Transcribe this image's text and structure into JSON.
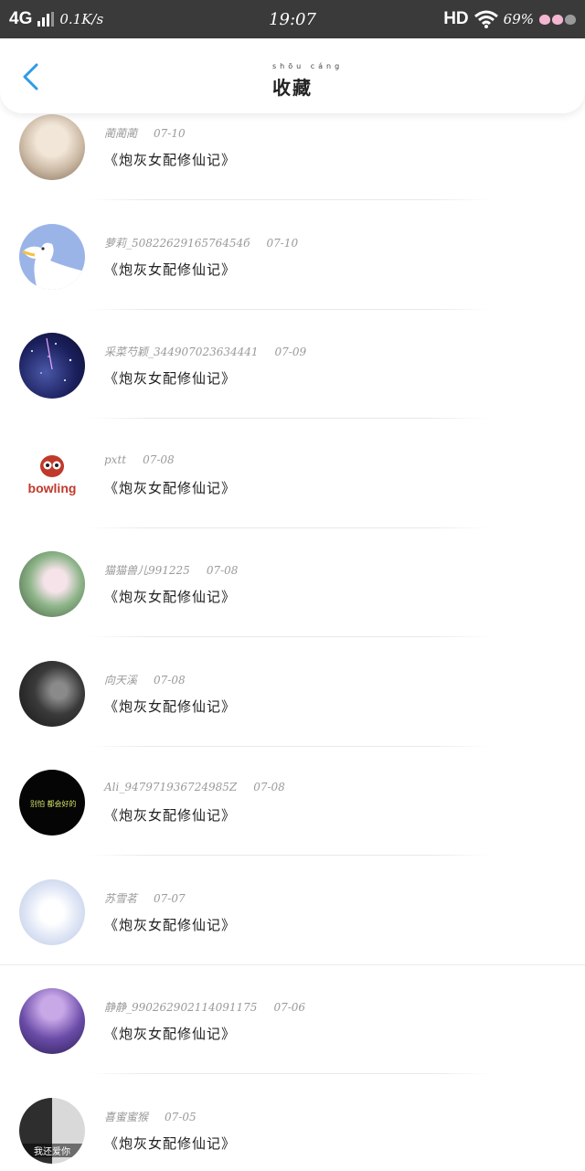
{
  "status_bar": {
    "network": "4G",
    "speed": "0.1K/s",
    "time": "19:07",
    "hd": "HD",
    "battery": "69%"
  },
  "header": {
    "title": "收藏",
    "title_pinyin": "shōu cáng"
  },
  "items": [
    {
      "name": "蔺蔺蔺",
      "date": "07-10",
      "book": "《炮灰女配修仙记》",
      "avatar_colors": [
        "#c9b7a2",
        "#f2e6d8"
      ]
    },
    {
      "name": "萝莉_5082262916576454б",
      "date": "07-10",
      "book": "《炮灰女配修仙记》",
      "avatar_colors": [
        "#9bb4e8",
        "#ffffff"
      ]
    },
    {
      "name": "采菜芍颖_344907023634441",
      "date": "07-09",
      "book": "《炮灰女配修仙记》",
      "avatar_colors": [
        "#1a1f5c",
        "#4a58a8"
      ]
    },
    {
      "name": "pxtt",
      "date": "07-08",
      "book": "《炮灰女配修仙记》",
      "avatar_colors": [
        "#ffffff",
        "#c0392b"
      ]
    },
    {
      "name": "猫猫兽儿991225",
      "date": "07-08",
      "book": "《炮灰女配修仙记》",
      "avatar_colors": [
        "#8fb58a",
        "#f0dce4"
      ]
    },
    {
      "name": "向天溪",
      "date": "07-08",
      "book": "《炮灰女配修仙记》",
      "avatar_colors": [
        "#2b2b2b",
        "#6e6e6e"
      ]
    },
    {
      "name": "Ali_947971936724985Z",
      "date": "07-08",
      "book": "《炮灰女配修仙记》",
      "avatar_colors": [
        "#000000",
        "#1c1c1c"
      ]
    },
    {
      "name": "苏雪茗",
      "date": "07-07",
      "book": "《炮灰女配修仙记》",
      "avatar_colors": [
        "#dfe6f5",
        "#ffffff"
      ]
    },
    {
      "name": "静静_990262902114091175",
      "date": "07-06",
      "book": "《炮灰女配修仙记》",
      "avatar_colors": [
        "#6a4ca8",
        "#c9a8e8"
      ]
    },
    {
      "name": "喜蜜蜜猴",
      "date": "07-05",
      "book": "《炮灰女配修仙记》",
      "avatar_colors": [
        "#2e2e2e",
        "#d9d9d9"
      ]
    }
  ],
  "avatar_text": {
    "bowling": "bowling",
    "line1": "我还爱你",
    "line2": "别怕 都会好的"
  },
  "colors": {
    "accent": "#2e9be6",
    "status_bar_bg": "#3a3a3a",
    "meta_text": "#9a9a9a"
  }
}
